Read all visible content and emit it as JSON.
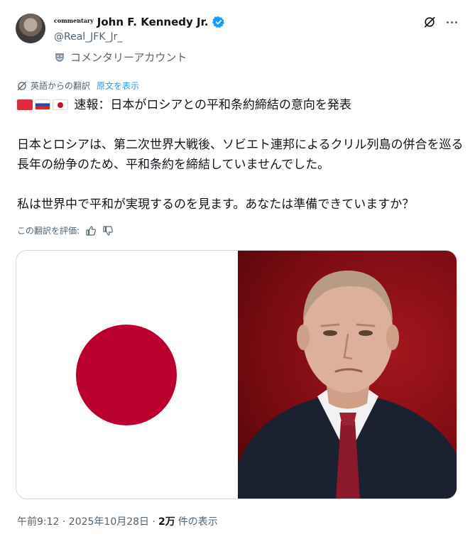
{
  "author": {
    "affiliation_badge": "commentary",
    "display_name": "John F. Kennedy Jr.",
    "handle": "@Real_JFK_Jr_",
    "label": "コメンタリーアカウント"
  },
  "translation": {
    "label": "英語からの翻訳",
    "show_original": "原文を表示",
    "rate_label": "この翻訳を評価:"
  },
  "post": {
    "headline": "速報：日本がロシアとの平和条約締結の意向を発表",
    "paragraph_1": "日本とロシアは、第二次世界大戦後、ソビエト連邦によるクリル列島の併合を巡る長年の紛争のため、平和条約を締結していませんでした。",
    "paragraph_2": "私は世界中で平和が実現するのを見ます。あなたは準備できていますか？"
  },
  "meta": {
    "timestamp": "午前9:12 · 2025年10月28日 ·",
    "views_count": "2万",
    "views_label": "件の表示"
  },
  "colors": {
    "accent": "#1d9bf0",
    "text_primary": "#0f1419",
    "text_secondary": "#536471",
    "japan_red": "#bc002d"
  }
}
